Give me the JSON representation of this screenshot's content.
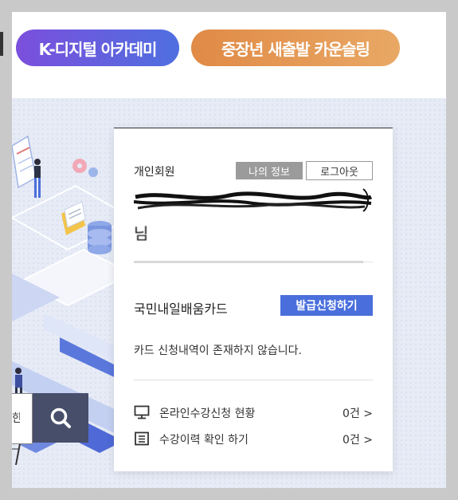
{
  "top_nav": {
    "buttons": [
      {
        "label": "K-디지털 아카데미",
        "color": "#6a5ae0"
      },
      {
        "label": "중장년 새출발 카운슬링",
        "color": "#e39452"
      }
    ]
  },
  "search": {
    "icon": "search-icon",
    "partial_text": "한"
  },
  "member_card": {
    "member_type": "개인회원",
    "my_info_label": "나의 정보",
    "logout_label": "로그아웃",
    "username_suffix": "님",
    "card_name": "국민내일배움카드",
    "issue_button_label": "발급신청하기",
    "card_status": "카드 신청내역이 존재하지 않습니다.",
    "summary": [
      {
        "icon": "monitor-icon",
        "label": "온라인수강신청 현황",
        "count": "0건 >"
      },
      {
        "icon": "list-icon",
        "label": "수강이력 확인 하기",
        "count": "0건 >"
      }
    ],
    "accent_color": "#4a6fdc"
  }
}
